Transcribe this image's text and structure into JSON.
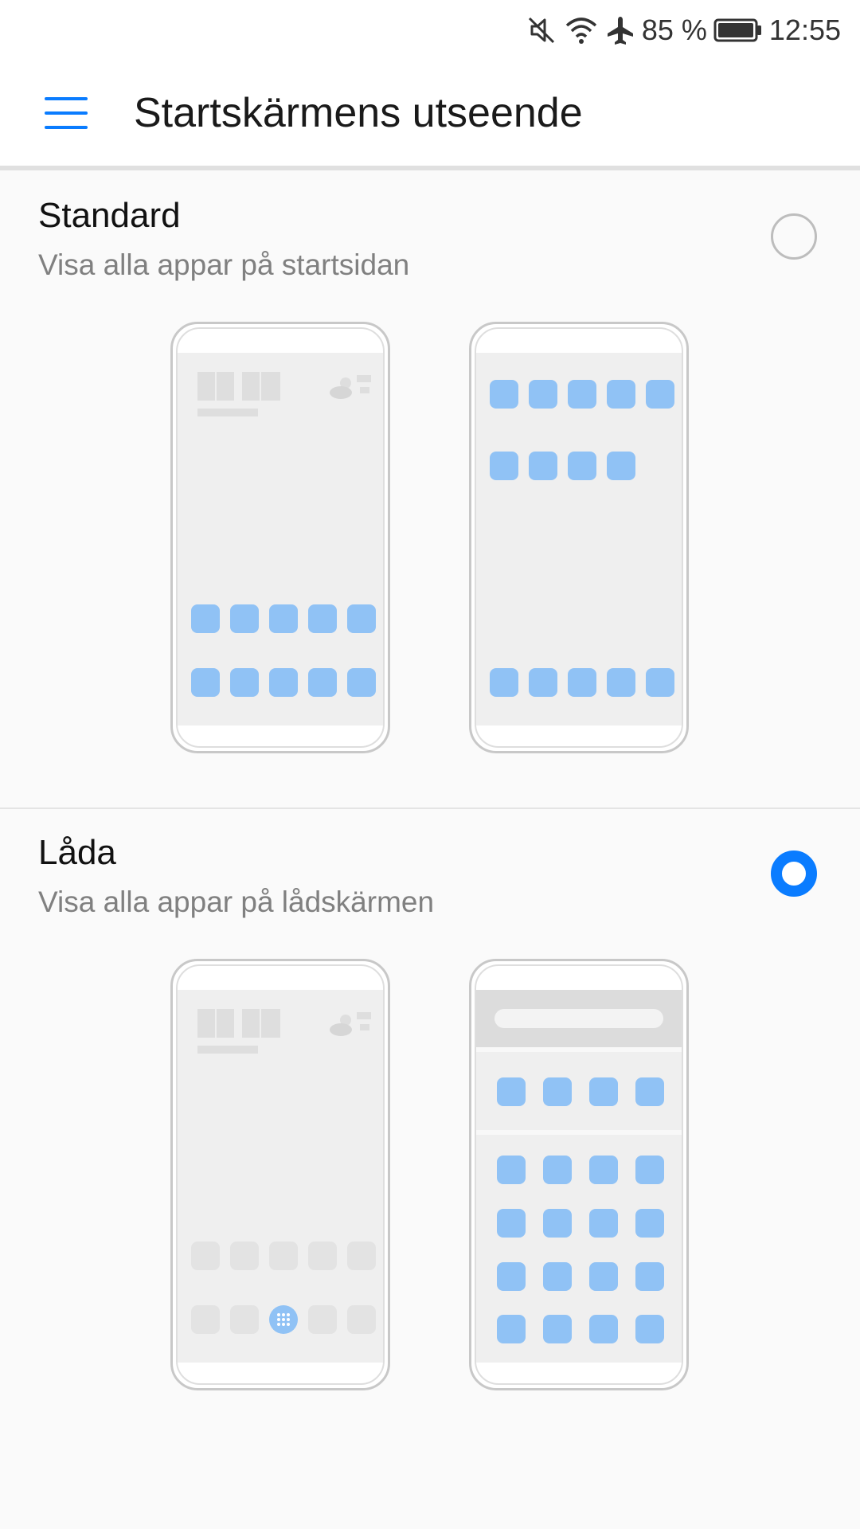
{
  "status_bar": {
    "battery_percent": "85 %",
    "time": "12:55",
    "icons": [
      "muted-icon",
      "wifi-icon",
      "airplane-icon",
      "battery-icon"
    ]
  },
  "app_bar": {
    "menu_icon": "menu-icon",
    "title": "Startskärmens utseende"
  },
  "options": [
    {
      "title": "Standard",
      "subtitle": "Visa alla appar på startsidan",
      "selected": false
    },
    {
      "title": "Låda",
      "subtitle": "Visa alla appar på lådskärmen",
      "selected": true
    }
  ],
  "colors": {
    "accent": "#0a7cff",
    "app_icon": "#90c2f5"
  }
}
